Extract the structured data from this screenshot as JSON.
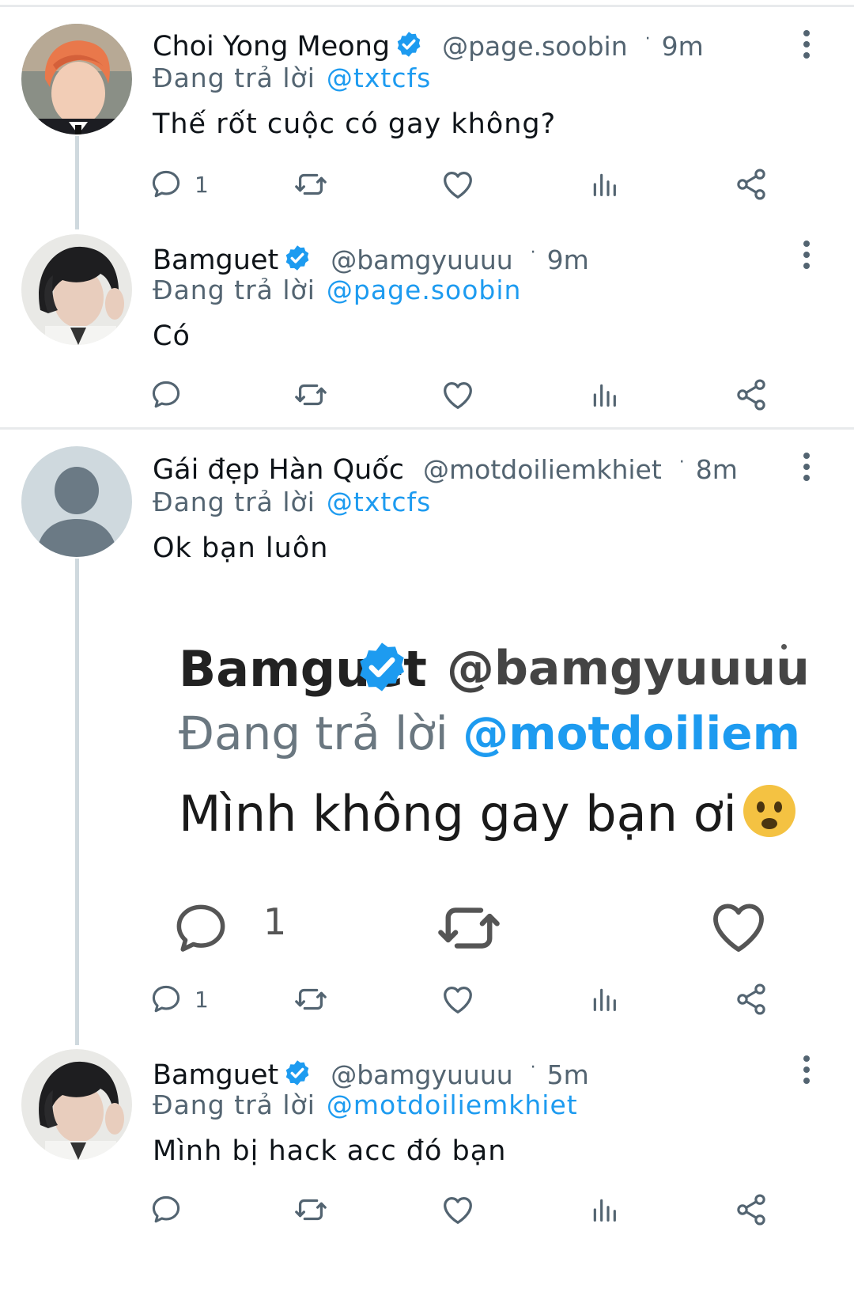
{
  "tweets": [
    {
      "name": "Choi Yong Meong",
      "handle": "@page.soobin",
      "time": "9m",
      "reply_prefix": "Đang trả lời",
      "reply_to": "@txtcfs",
      "text": "Thế rốt cuộc có gay không?",
      "reply_count": "1",
      "avatar": "red-haired-boy-photo"
    },
    {
      "name": "Bamguet",
      "handle": "@bamgyuuuu",
      "time": "9m",
      "reply_prefix": "Đang trả lời",
      "reply_to": "@page.soobin",
      "text": "Có",
      "reply_count": "",
      "avatar": "dark-haired-boy-photo"
    },
    {
      "name": "Gái đẹp Hàn Quốc",
      "handle": "@motdoiliemkhiet",
      "time": "8m",
      "reply_prefix": "Đang trả lời",
      "reply_to": "@txtcfs",
      "text": "Ok bạn luôn",
      "reply_count": "1",
      "avatar": "default-profile-silhouette",
      "embedded": {
        "name": "Bamguet",
        "handle": "@bamgyuuuu",
        "reply_prefix": "Đang trả lời",
        "reply_to": "@motdoiliem",
        "text": "Mình không gay bạn ơi",
        "emoji": "frowning-face-emoji",
        "reply_count": "1"
      }
    },
    {
      "name": "Bamguet",
      "handle": "@bamgyuuuu",
      "time": "5m",
      "reply_prefix": "Đang trả lời",
      "reply_to": "@motdoiliemkhiet",
      "text": "Mình bị hack acc đó bạn",
      "reply_count": "",
      "avatar": "dark-haired-boy-photo"
    }
  ],
  "icons": {
    "reply": "speech-bubble-icon",
    "retweet": "retweet-icon",
    "like": "heart-icon",
    "views": "bar-chart-icon",
    "share": "share-icon",
    "verified": "verified-badge-icon",
    "more": "more-vertical-icon"
  },
  "colors": {
    "accent": "#1d9bf0",
    "secondary_text": "#536471",
    "primary_text": "#0f1419",
    "divider": "#e8eaec"
  }
}
